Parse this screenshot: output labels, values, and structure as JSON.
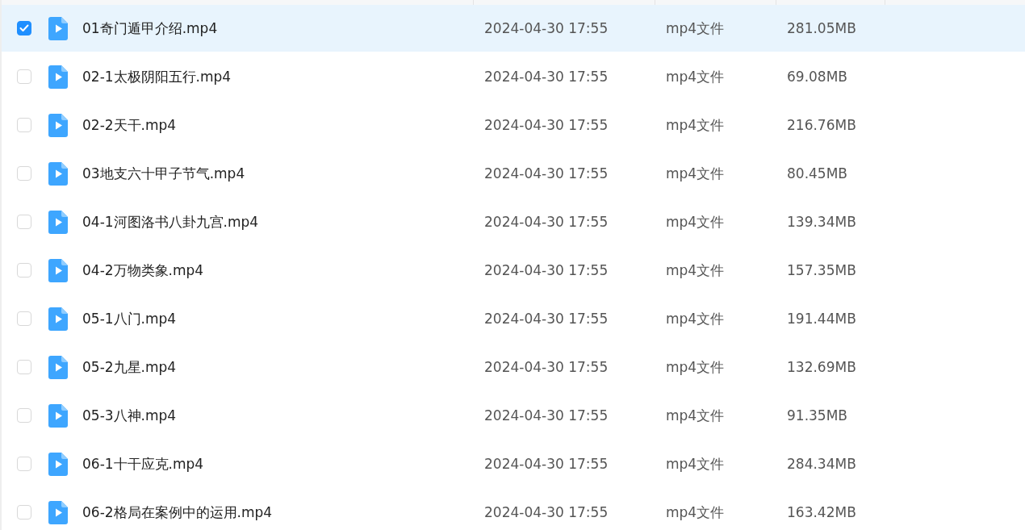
{
  "files": [
    {
      "name": "01奇门遁甲介绍.mp4",
      "modified": "2024-04-30 17:55",
      "type": "mp4文件",
      "size": "281.05MB",
      "selected": true
    },
    {
      "name": "02-1太极阴阳五行.mp4",
      "modified": "2024-04-30 17:55",
      "type": "mp4文件",
      "size": "69.08MB",
      "selected": false
    },
    {
      "name": "02-2天干.mp4",
      "modified": "2024-04-30 17:55",
      "type": "mp4文件",
      "size": "216.76MB",
      "selected": false
    },
    {
      "name": "03地支六十甲子节气.mp4",
      "modified": "2024-04-30 17:55",
      "type": "mp4文件",
      "size": "80.45MB",
      "selected": false
    },
    {
      "name": "04-1河图洛书八卦九宫.mp4",
      "modified": "2024-04-30 17:55",
      "type": "mp4文件",
      "size": "139.34MB",
      "selected": false
    },
    {
      "name": "04-2万物类象.mp4",
      "modified": "2024-04-30 17:55",
      "type": "mp4文件",
      "size": "157.35MB",
      "selected": false
    },
    {
      "name": "05-1八门.mp4",
      "modified": "2024-04-30 17:55",
      "type": "mp4文件",
      "size": "191.44MB",
      "selected": false
    },
    {
      "name": "05-2九星.mp4",
      "modified": "2024-04-30 17:55",
      "type": "mp4文件",
      "size": "132.69MB",
      "selected": false
    },
    {
      "name": "05-3八神.mp4",
      "modified": "2024-04-30 17:55",
      "type": "mp4文件",
      "size": "91.35MB",
      "selected": false
    },
    {
      "name": "06-1十干应克.mp4",
      "modified": "2024-04-30 17:55",
      "type": "mp4文件",
      "size": "284.34MB",
      "selected": false
    },
    {
      "name": "06-2格局在案例中的运用.mp4",
      "modified": "2024-04-30 17:55",
      "type": "mp4文件",
      "size": "163.42MB",
      "selected": false
    }
  ]
}
